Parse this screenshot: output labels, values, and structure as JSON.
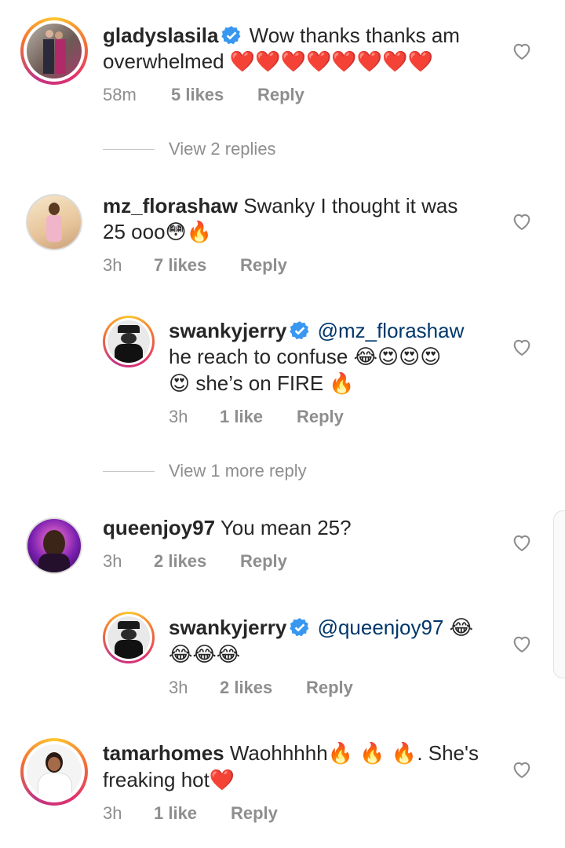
{
  "comments": [
    {
      "username": "gladyslasila",
      "verified": true,
      "text": "Wow thanks thanks am",
      "text_line2": "overwhelmed",
      "emoji": "❤️❤️❤️❤️❤️❤️❤️❤️",
      "time": "58m",
      "likes": "5 likes",
      "reply": "Reply",
      "view_replies": "View 2 replies"
    },
    {
      "username": "mz_florashaw",
      "text": "Swanky I thought it was",
      "text_line2": "25 ooo",
      "emoji": "😳🔥",
      "time": "3h",
      "likes": "7 likes",
      "reply": "Reply"
    },
    {
      "username": "swankyjerry",
      "verified": true,
      "mention": "@mz_florashaw",
      "text_line2": "he reach to confuse",
      "emoji_line2": "😂😍😍😍",
      "emoji_line3": "😍",
      "text_line3": "she’s on FIRE",
      "emoji_line3_end": "🔥",
      "time": "3h",
      "likes": "1 like",
      "reply": "Reply",
      "view_replies": "View 1 more reply"
    },
    {
      "username": "queenjoy97",
      "text": "You mean 25?",
      "time": "3h",
      "likes": "2 likes",
      "reply": "Reply"
    },
    {
      "username": "swankyjerry",
      "verified": true,
      "mention": "@queenjoy97",
      "emoji": "😂",
      "emoji_line2": "😂😂😂",
      "time": "3h",
      "likes": "2 likes",
      "reply": "Reply"
    },
    {
      "username": "tamarhomes",
      "text": "Waohhhhh",
      "emoji": "🔥 🔥 🔥",
      "text_after": ". She's",
      "text_line2": "freaking hot",
      "emoji_line2": "❤️",
      "time": "3h",
      "likes": "1 like",
      "reply": "Reply"
    }
  ],
  "colors": {
    "verified": "#3897f0",
    "mention": "#00376b",
    "muted": "#8e8e8e"
  }
}
